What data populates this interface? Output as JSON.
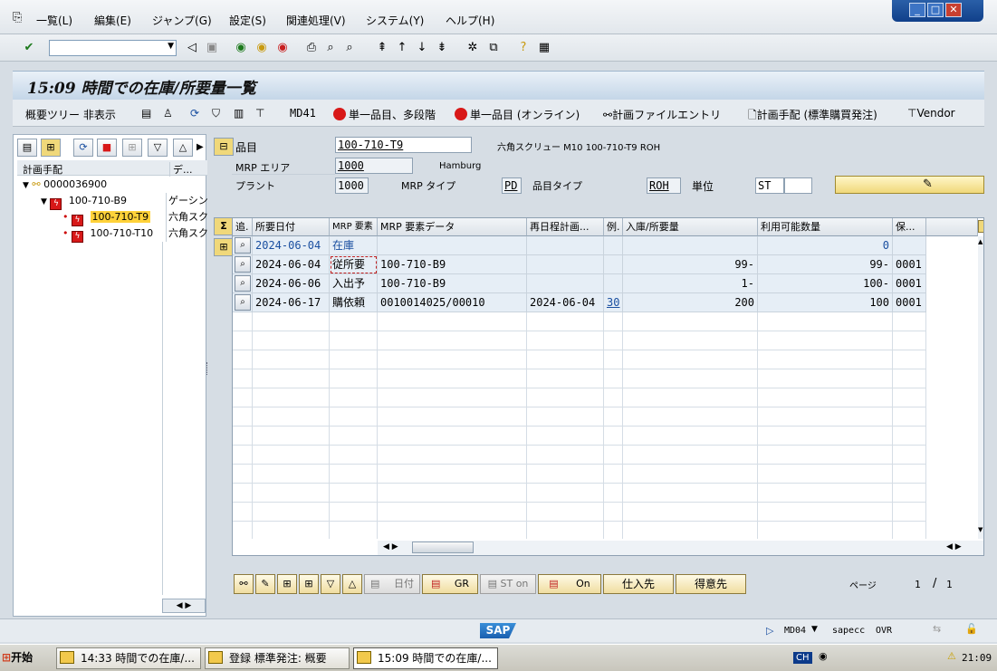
{
  "menu": {
    "items": [
      "一覧(L)",
      "編集(E)",
      "ジャンプ(G)",
      "設定(S)",
      "関連処理(V)",
      "システム(Y)",
      "ヘルプ(H)"
    ]
  },
  "window_controls": {
    "minimize": "_",
    "restore": "□",
    "close": "✕"
  },
  "title": "15:09 時間での在庫/所要量一覧",
  "app_toolbar": {
    "tree_toggle": "概要ツリー 非表示",
    "md41": "MD41",
    "multi_level": "単一品目、多段階",
    "online": "単一品目 (オンライン)",
    "planning_file": "計画ファイルエントリ",
    "procurement": "計画手配 (標準購買発注)",
    "vendor": "Vendor"
  },
  "tree": {
    "header_col1": "計画手配",
    "header_col2": "デ...",
    "rows": [
      {
        "label": "0000036900",
        "desc": ""
      },
      {
        "label": "100-710-B9",
        "desc": "ゲーシン"
      },
      {
        "label": "100-710-T9",
        "desc": "六角スク"
      },
      {
        "label": "100-710-T10",
        "desc": "六角スク"
      }
    ]
  },
  "header": {
    "material_label": "品目",
    "material_value": "100-710-T9",
    "material_desc": "六角スクリュー M10 100-710-T9 ROH",
    "mrp_area_label": "MRP エリア",
    "mrp_area_value": "1000",
    "mrp_area_desc": "Hamburg",
    "plant_label": "プラント",
    "plant_value": "1000",
    "mrp_type_label": "MRP タイプ",
    "mrp_type_value": "PD",
    "material_type_label": "品目タイプ",
    "material_type_value": "ROH",
    "unit_label": "単位",
    "unit_value": "ST"
  },
  "grid": {
    "columns": [
      "追.",
      "所要日付",
      "MRP 要素",
      "MRP 要素データ",
      "再日程計画...",
      "例.",
      "入庫/所要量",
      "利用可能数量",
      "保..."
    ],
    "rows": [
      {
        "date": "2024-06-04",
        "element": "在庫",
        "data": "",
        "resched": "",
        "exc": "",
        "qty": "",
        "avail": "0",
        "sloc": ""
      },
      {
        "date": "2024-06-04",
        "element": "従所要",
        "data": "100-710-B9",
        "resched": "",
        "exc": "",
        "qty": "99-",
        "avail": "99-",
        "sloc": "0001"
      },
      {
        "date": "2024-06-06",
        "element": "入出予",
        "data": "100-710-B9",
        "resched": "",
        "exc": "",
        "qty": "1-",
        "avail": "100-",
        "sloc": "0001"
      },
      {
        "date": "2024-06-17",
        "element": "購依頼",
        "data": "0010014025/00010",
        "resched": "2024-06-04",
        "exc": "30",
        "qty": "200",
        "avail": "100",
        "sloc": "0001"
      }
    ]
  },
  "bottom_buttons": {
    "date": "日付",
    "gr": "GR",
    "st_on": "ST on",
    "on": "On",
    "vendor": "仕入先",
    "customer": "得意先"
  },
  "pager": {
    "label": "ページ",
    "current": "1",
    "sep": "/",
    "total": "1"
  },
  "status": {
    "tcode": "MD04",
    "system": "sapecc",
    "mode": "OVR",
    "logo": "SAP"
  },
  "taskbar": {
    "start": "开始",
    "tasks": [
      "14:33 時間での在庫/...",
      "登録 標準発注: 概要",
      "15:09 時間での在庫/..."
    ],
    "lang": "CH",
    "clock": "21:09"
  },
  "colors": {
    "accent_blue": "#1a4fa0",
    "title_grad": "#c4d6e8",
    "red_icon": "#d81818",
    "button_yellow": "#f0dda0"
  }
}
